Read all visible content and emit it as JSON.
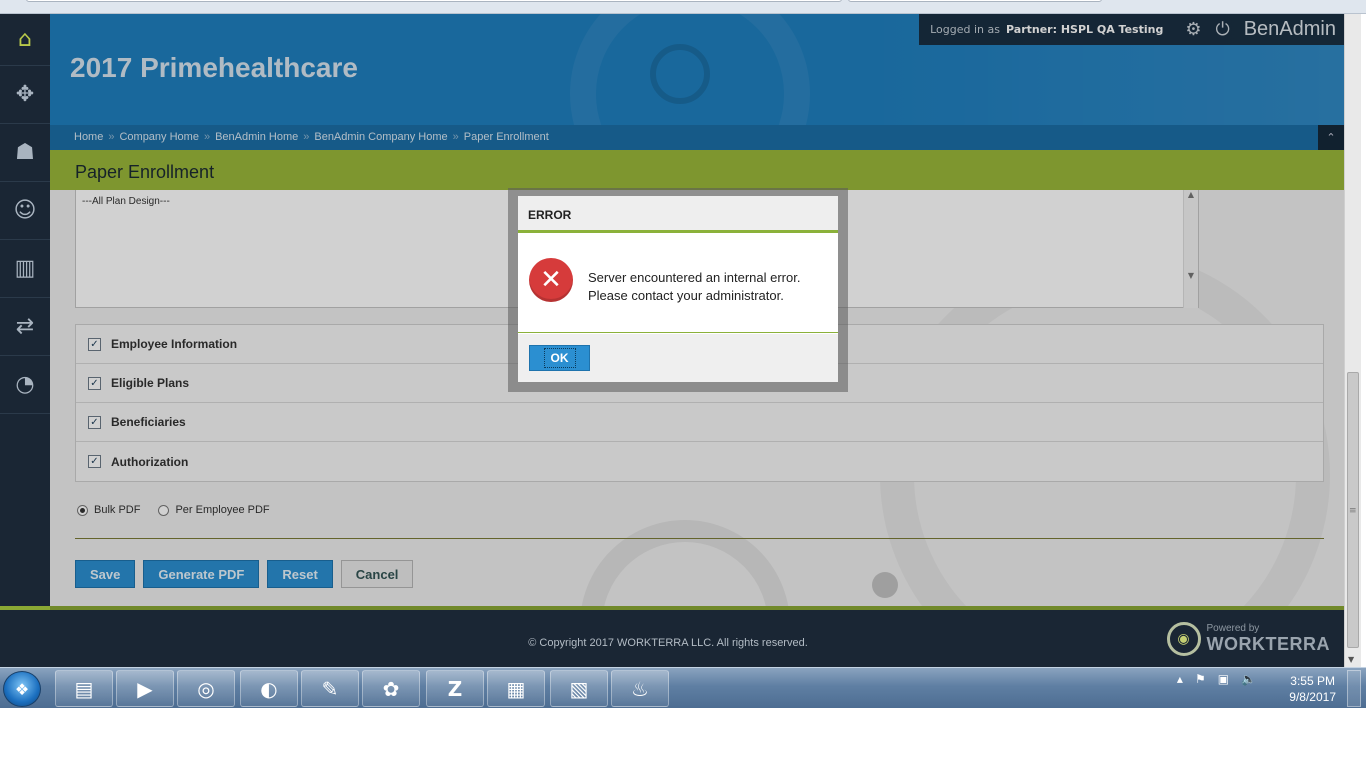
{
  "header": {
    "title": "2017 Primehealthcare",
    "logged_in_label": "Logged in as",
    "partner_label": "Partner:  HSPL QA Testing",
    "brand": "BenAdmin"
  },
  "breadcrumb": [
    "Home",
    "Company Home",
    "BenAdmin Home",
    "BenAdmin Company Home",
    "Paper Enrollment"
  ],
  "breadcrumb_sep": "»",
  "page_title": "Paper Enrollment",
  "plan_list": {
    "selected_option": "---All Plan Design---"
  },
  "sections": [
    {
      "label": "Employee Information",
      "checked": true
    },
    {
      "label": "Eligible Plans",
      "checked": true
    },
    {
      "label": "Beneficiaries",
      "checked": true
    },
    {
      "label": "Authorization",
      "checked": true
    }
  ],
  "pdf_options": {
    "bulk_label": "Bulk PDF",
    "per_employee_label": "Per Employee PDF",
    "selected": "Bulk PDF"
  },
  "buttons": {
    "save": "Save",
    "generate": "Generate PDF",
    "reset": "Reset",
    "cancel": "Cancel"
  },
  "footer": {
    "copyright": "© Copyright 2017 WORKTERRA LLC. All rights reserved.",
    "powered_by": "Powered by",
    "powered_brand": "WORKTERRA"
  },
  "dialog": {
    "title": "ERROR",
    "message_line1": "Server encountered an internal error.",
    "message_line2": "Please contact your administrator.",
    "ok_label": "OK"
  },
  "taskbar": {
    "apps": [
      "file-explorer-icon",
      "media-player-icon",
      "chrome-icon",
      "firefox-icon",
      "notepad-icon",
      "paint-icon",
      "z-app-icon",
      "image-viewer-icon",
      "spreadsheet-icon",
      "fire-app-icon"
    ],
    "z_label": "Z",
    "time": "3:55 PM",
    "date": "9/8/2017"
  },
  "colors": {
    "accent_blue": "#1f7fbf",
    "accent_green": "#9ab83a",
    "error_red": "#d63b3b",
    "nav_dark": "#1a2634"
  }
}
